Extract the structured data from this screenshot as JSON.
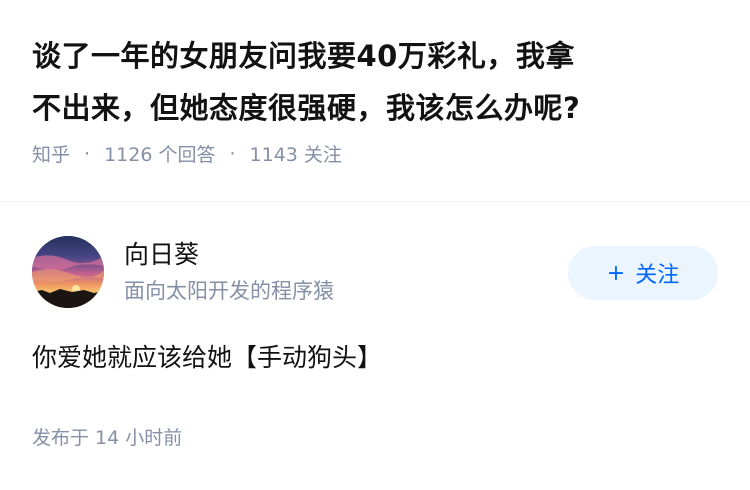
{
  "question": {
    "title_line1": "谈了一年的女朋友问我要40万彩礼，我拿",
    "title_line2": "不出来，但她态度很强硬，我该怎么办呢?",
    "source": "知乎",
    "separator": "·",
    "answers_count": "1126 个回答",
    "followers_count": "1143 关注"
  },
  "answer": {
    "author": {
      "name": "向日葵",
      "bio": "面向太阳开发的程序猿",
      "avatar": "sunset-avatar"
    },
    "follow_button": {
      "plus": "+",
      "label": "关注"
    },
    "content": "你爱她就应该给她【手动狗头】",
    "published": "发布于 14 小时前"
  },
  "colors": {
    "text": "#121212",
    "meta": "#8590a6",
    "accent": "#0066ff",
    "follow_bg": "#ebf5ff",
    "divider": "#f0f2f7"
  }
}
